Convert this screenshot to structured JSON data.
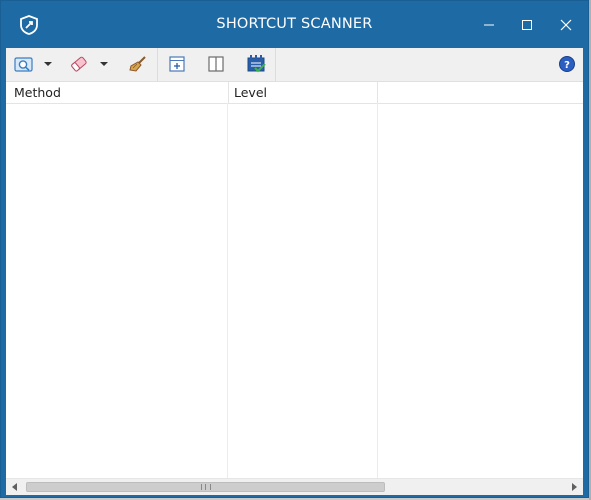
{
  "window": {
    "title": "SHORTCUT SCANNER"
  },
  "titlebar_buttons": [
    "minimize",
    "maximize",
    "close"
  ],
  "toolbar": {
    "buttons": [
      {
        "icon": "scan-icon",
        "has_dropdown": true
      },
      {
        "icon": "eraser-icon",
        "has_dropdown": true
      },
      {
        "icon": "broom-icon",
        "has_dropdown": false
      },
      {
        "icon": "expand-all-icon",
        "has_dropdown": false
      },
      {
        "icon": "columns-icon",
        "has_dropdown": false
      },
      {
        "icon": "checklist-icon",
        "has_dropdown": false
      },
      {
        "icon": "help-icon",
        "has_dropdown": false
      }
    ]
  },
  "grid": {
    "columns": [
      "Method",
      "Level",
      ""
    ],
    "rows": []
  },
  "colors": {
    "titlebar": "#1d6aa5",
    "toolbar": "#f0f0f0",
    "accent": "#2a73c4"
  }
}
